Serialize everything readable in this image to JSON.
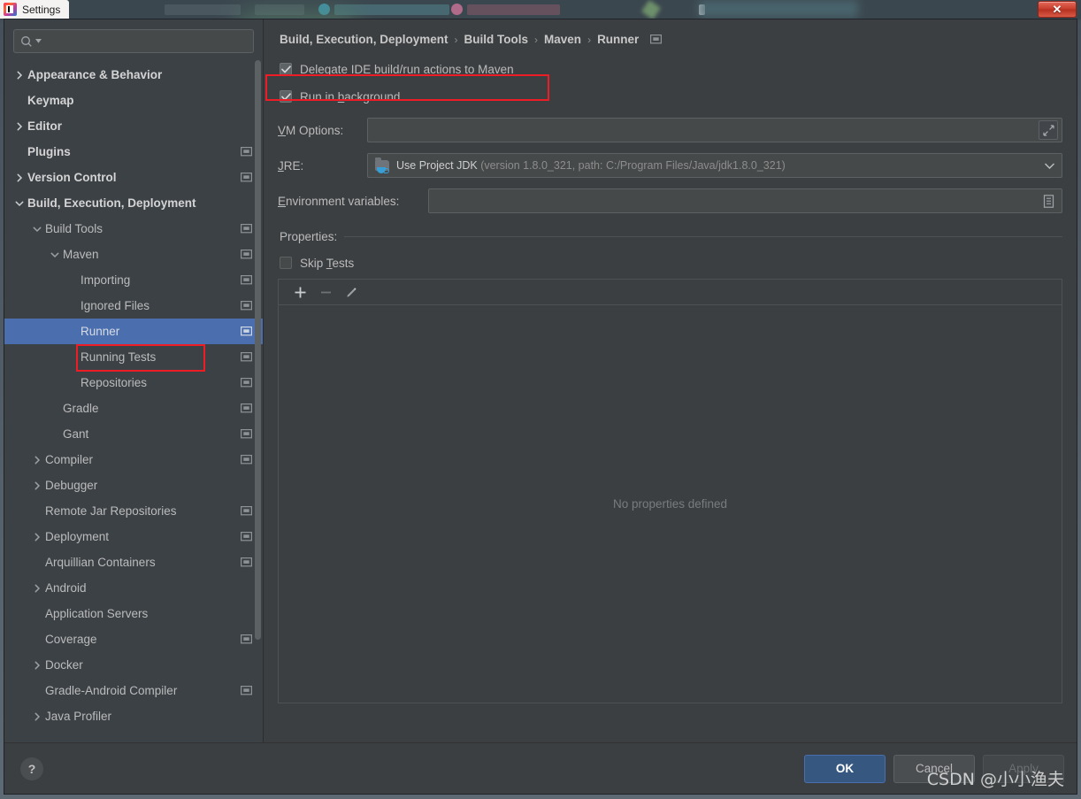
{
  "window": {
    "title": "Settings",
    "app_icon": "intellij-logo-icon",
    "close_label": "✕"
  },
  "sidebar": {
    "search": {
      "placeholder": "",
      "value": "",
      "icon": "search-icon"
    },
    "items": [
      {
        "label": "Appearance & Behavior",
        "indent": 0,
        "twisty": "collapsed",
        "bold": true,
        "screen_icon": false,
        "selected": false
      },
      {
        "label": "Keymap",
        "indent": 0,
        "twisty": "none",
        "bold": true,
        "screen_icon": false,
        "selected": false
      },
      {
        "label": "Editor",
        "indent": 0,
        "twisty": "collapsed",
        "bold": true,
        "screen_icon": false,
        "selected": false
      },
      {
        "label": "Plugins",
        "indent": 0,
        "twisty": "none",
        "bold": true,
        "screen_icon": true,
        "selected": false
      },
      {
        "label": "Version Control",
        "indent": 0,
        "twisty": "collapsed",
        "bold": true,
        "screen_icon": true,
        "selected": false
      },
      {
        "label": "Build, Execution, Deployment",
        "indent": 0,
        "twisty": "expanded",
        "bold": true,
        "screen_icon": false,
        "selected": false
      },
      {
        "label": "Build Tools",
        "indent": 1,
        "twisty": "expanded",
        "bold": false,
        "screen_icon": true,
        "selected": false
      },
      {
        "label": "Maven",
        "indent": 2,
        "twisty": "expanded",
        "bold": false,
        "screen_icon": true,
        "selected": false
      },
      {
        "label": "Importing",
        "indent": 3,
        "twisty": "none",
        "bold": false,
        "screen_icon": true,
        "selected": false
      },
      {
        "label": "Ignored Files",
        "indent": 3,
        "twisty": "none",
        "bold": false,
        "screen_icon": true,
        "selected": false
      },
      {
        "label": "Runner",
        "indent": 3,
        "twisty": "none",
        "bold": false,
        "screen_icon": true,
        "selected": true
      },
      {
        "label": "Running Tests",
        "indent": 3,
        "twisty": "none",
        "bold": false,
        "screen_icon": true,
        "selected": false
      },
      {
        "label": "Repositories",
        "indent": 3,
        "twisty": "none",
        "bold": false,
        "screen_icon": true,
        "selected": false
      },
      {
        "label": "Gradle",
        "indent": 2,
        "twisty": "none",
        "bold": false,
        "screen_icon": true,
        "selected": false
      },
      {
        "label": "Gant",
        "indent": 2,
        "twisty": "none",
        "bold": false,
        "screen_icon": true,
        "selected": false
      },
      {
        "label": "Compiler",
        "indent": 1,
        "twisty": "collapsed",
        "bold": false,
        "screen_icon": true,
        "selected": false
      },
      {
        "label": "Debugger",
        "indent": 1,
        "twisty": "collapsed",
        "bold": false,
        "screen_icon": false,
        "selected": false
      },
      {
        "label": "Remote Jar Repositories",
        "indent": 1,
        "twisty": "none",
        "bold": false,
        "screen_icon": true,
        "selected": false
      },
      {
        "label": "Deployment",
        "indent": 1,
        "twisty": "collapsed",
        "bold": false,
        "screen_icon": true,
        "selected": false
      },
      {
        "label": "Arquillian Containers",
        "indent": 1,
        "twisty": "none",
        "bold": false,
        "screen_icon": true,
        "selected": false
      },
      {
        "label": "Android",
        "indent": 1,
        "twisty": "collapsed",
        "bold": false,
        "screen_icon": false,
        "selected": false
      },
      {
        "label": "Application Servers",
        "indent": 1,
        "twisty": "none",
        "bold": false,
        "screen_icon": false,
        "selected": false
      },
      {
        "label": "Coverage",
        "indent": 1,
        "twisty": "none",
        "bold": false,
        "screen_icon": true,
        "selected": false
      },
      {
        "label": "Docker",
        "indent": 1,
        "twisty": "collapsed",
        "bold": false,
        "screen_icon": false,
        "selected": false
      },
      {
        "label": "Gradle-Android Compiler",
        "indent": 1,
        "twisty": "none",
        "bold": false,
        "screen_icon": true,
        "selected": false
      },
      {
        "label": "Java Profiler",
        "indent": 1,
        "twisty": "collapsed",
        "bold": false,
        "screen_icon": false,
        "selected": false
      }
    ]
  },
  "content": {
    "breadcrumb": [
      "Build, Execution, Deployment",
      "Build Tools",
      "Maven",
      "Runner"
    ],
    "breadcrumb_separator": "›",
    "breadcrumb_screen_icon": "project-scope-icon",
    "delegate_checkbox": {
      "label_mnemonic": "D",
      "label_rest": "elegate IDE build/run actions to Maven",
      "checked": true
    },
    "background_checkbox": {
      "label_pre": "Run in ",
      "label_mnemonic": "b",
      "label_rest": "ackground",
      "checked": true
    },
    "vm_options": {
      "label_mnemonic": "V",
      "label_rest": "M Options:",
      "value": "",
      "expand_icon": "expand-icon"
    },
    "jre": {
      "label_mnemonic": "J",
      "label_rest": "RE:",
      "value_main": "Use Project JDK",
      "value_detail": "(version 1.8.0_321, path: C:/Program Files/Java/jdk1.8.0_321)",
      "icon": "jdk-folder-icon",
      "arrow": "chevron-down-icon"
    },
    "environment_variables": {
      "label_mnemonic": "E",
      "label_rest": "nvironment variables:",
      "value": "",
      "browse_icon": "list-editor-icon"
    },
    "properties": {
      "title": "Properties:",
      "skip_tests": {
        "label_pre": "Skip ",
        "label_mnemonic": "T",
        "label_rest": "ests",
        "checked": false
      },
      "toolbar": [
        {
          "name": "add-property-button",
          "glyph": "+",
          "enabled": true
        },
        {
          "name": "remove-property-button",
          "glyph": "−",
          "enabled": false
        },
        {
          "name": "edit-property-button",
          "glyph": "pencil",
          "enabled": true
        }
      ],
      "empty_text": "No properties defined"
    }
  },
  "footer": {
    "help_label": "?",
    "ok_label": "OK",
    "cancel_label": "Cancel",
    "apply_label": "Apply"
  },
  "watermark": "CSDN @小小渔夫",
  "colors": {
    "dialog_bg": "#3c3f41",
    "sidebar_bg": "#3c4146",
    "selection_blue": "#4b6eaf",
    "primary_button": "#365880",
    "annotation_red": "#ee1c25",
    "text": "#bbbbbb",
    "muted_text": "#8d8d8d"
  }
}
